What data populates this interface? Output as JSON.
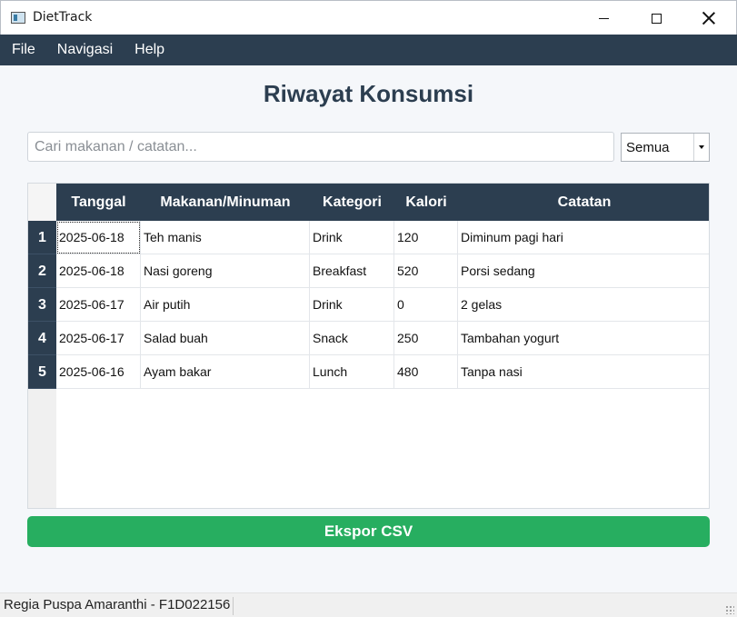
{
  "window": {
    "title": "DietTrack",
    "icon": "app-window-icon"
  },
  "menu": [
    "File",
    "Navigasi",
    "Help"
  ],
  "heading": "Riwayat Konsumsi",
  "search": {
    "placeholder": "Cari makanan / catatan...",
    "value": ""
  },
  "filter": {
    "selected": "Semua"
  },
  "table": {
    "columns": [
      "Tanggal",
      "Makanan/Minuman",
      "Kategori",
      "Kalori",
      "Catatan"
    ],
    "rows": [
      {
        "num": "1",
        "tanggal": "2025-06-18",
        "makanan": "Teh manis",
        "kategori": "Drink",
        "kalori": "120",
        "catatan": "Diminum pagi hari"
      },
      {
        "num": "2",
        "tanggal": "2025-06-18",
        "makanan": "Nasi goreng",
        "kategori": "Breakfast",
        "kalori": "520",
        "catatan": "Porsi sedang"
      },
      {
        "num": "3",
        "tanggal": "2025-06-17",
        "makanan": "Air putih",
        "kategori": "Drink",
        "kalori": "0",
        "catatan": "2 gelas"
      },
      {
        "num": "4",
        "tanggal": "2025-06-17",
        "makanan": "Salad buah",
        "kategori": "Snack",
        "kalori": "250",
        "catatan": "Tambahan yogurt"
      },
      {
        "num": "5",
        "tanggal": "2025-06-16",
        "makanan": "Ayam bakar",
        "kategori": "Lunch",
        "kalori": "480",
        "catatan": "Tanpa nasi"
      }
    ]
  },
  "export_button": "Ekspor CSV",
  "status": "Regia Puspa Amaranthi - F1D022156",
  "colors": {
    "primary": "#2c3e50",
    "accent": "#27ae60",
    "background": "#f5f7fa"
  }
}
